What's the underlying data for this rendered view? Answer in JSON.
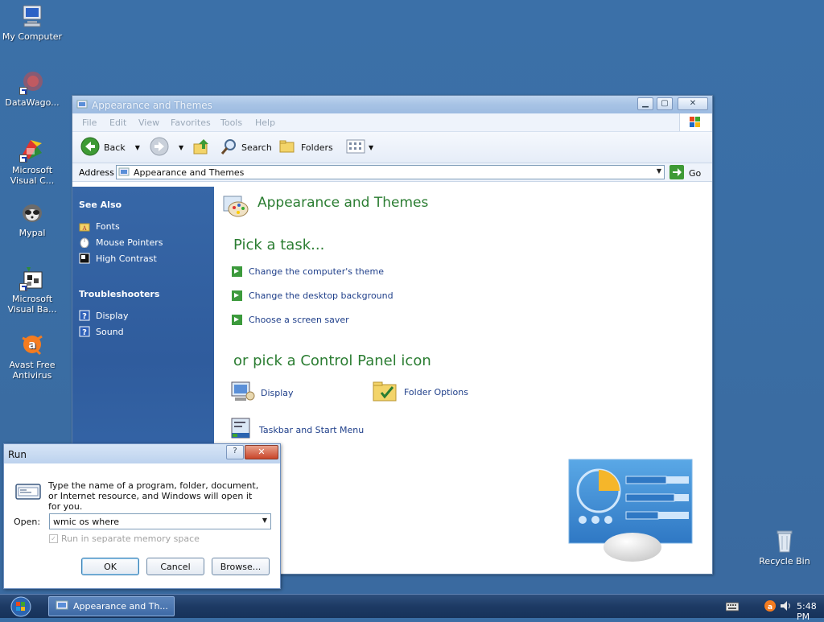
{
  "desktop": {
    "icons": [
      {
        "label": "My Computer",
        "icon": "my-computer-icon"
      },
      {
        "label": "DataWago...",
        "icon": "datawagon-icon"
      },
      {
        "label": "Microsoft Visual C...",
        "icon": "visual-c-icon"
      },
      {
        "label": "Mypal",
        "icon": "mypal-icon"
      },
      {
        "label": "Microsoft Visual Ba...",
        "icon": "visual-basic-icon"
      },
      {
        "label": "Avast Free Antivirus",
        "icon": "avast-icon"
      },
      {
        "label": "Recycle Bin",
        "icon": "recycle-bin-icon"
      }
    ]
  },
  "explorer": {
    "title": "Appearance and Themes",
    "menu": [
      "File",
      "Edit",
      "View",
      "Favorites",
      "Tools",
      "Help"
    ],
    "toolbar": {
      "back": "Back",
      "search": "Search",
      "folders": "Folders"
    },
    "address": {
      "label": "Address",
      "value": "Appearance and Themes",
      "go": "Go"
    },
    "sidebar": {
      "see_also_title": "See Also",
      "see_also": [
        "Fonts",
        "Mouse Pointers",
        "High Contrast"
      ],
      "troubleshooters_title": "Troubleshooters",
      "troubleshooters": [
        "Display",
        "Sound"
      ]
    },
    "content": {
      "heading": "Appearance and Themes",
      "pick_task": "Pick a task...",
      "tasks": [
        "Change the computer's theme",
        "Change the desktop background",
        "Choose a screen saver"
      ],
      "pick_icon": "or pick a Control Panel icon",
      "icons": [
        "Display",
        "Folder Options",
        "Taskbar and Start Menu"
      ]
    }
  },
  "run_dialog": {
    "title": "Run",
    "description": "Type the name of a program, folder, document, or Internet resource, and Windows will open it for you.",
    "open_label": "Open:",
    "open_value": "wmic os where",
    "checkbox_label": "Run in separate memory space",
    "ok": "OK",
    "cancel": "Cancel",
    "browse": "Browse..."
  },
  "taskbar": {
    "task_label": "Appearance and Th...",
    "clock": "5:48 PM"
  },
  "colors": {
    "green_heading": "#2b7d32",
    "link_blue": "#1f3f8a",
    "sidebar_blue": "#2f5c9d"
  }
}
